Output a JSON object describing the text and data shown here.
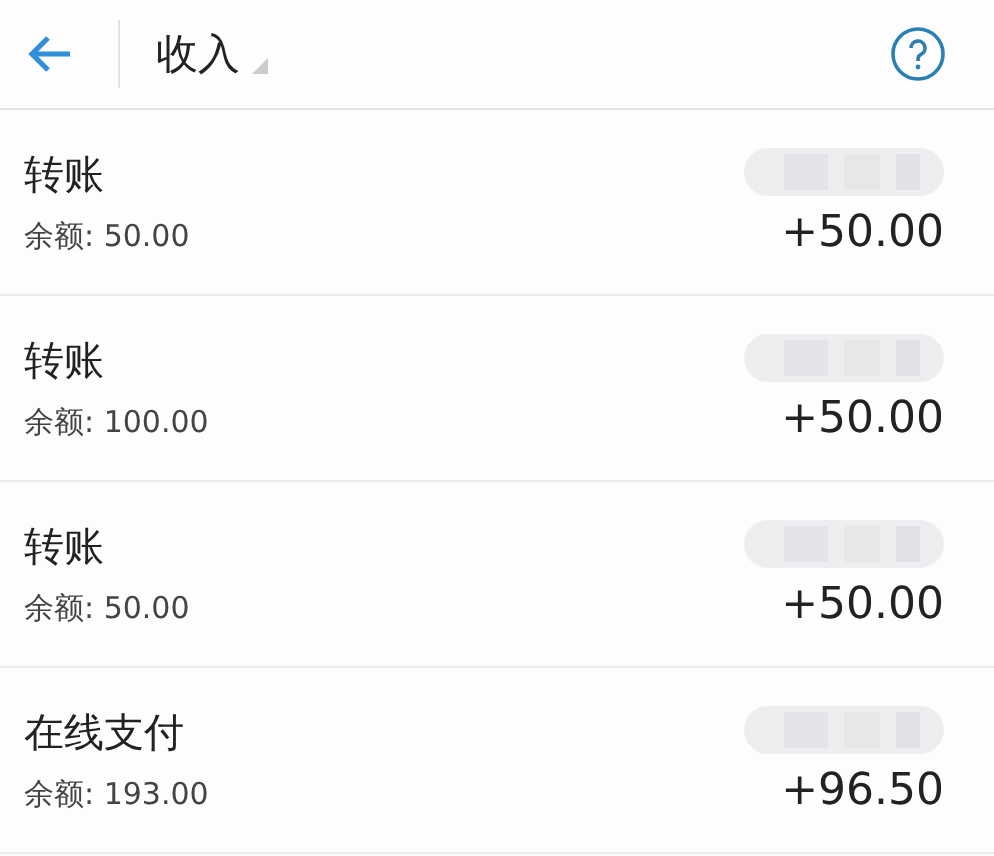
{
  "header": {
    "title": "收入"
  },
  "transactions": [
    {
      "title": "转账",
      "balance": "余额: 50.00",
      "amount": "+50.00"
    },
    {
      "title": "转账",
      "balance": "余额: 100.00",
      "amount": "+50.00"
    },
    {
      "title": "转账",
      "balance": "余额: 50.00",
      "amount": "+50.00"
    },
    {
      "title": "在线支付",
      "balance": "余额: 193.00",
      "amount": "+96.50"
    }
  ]
}
